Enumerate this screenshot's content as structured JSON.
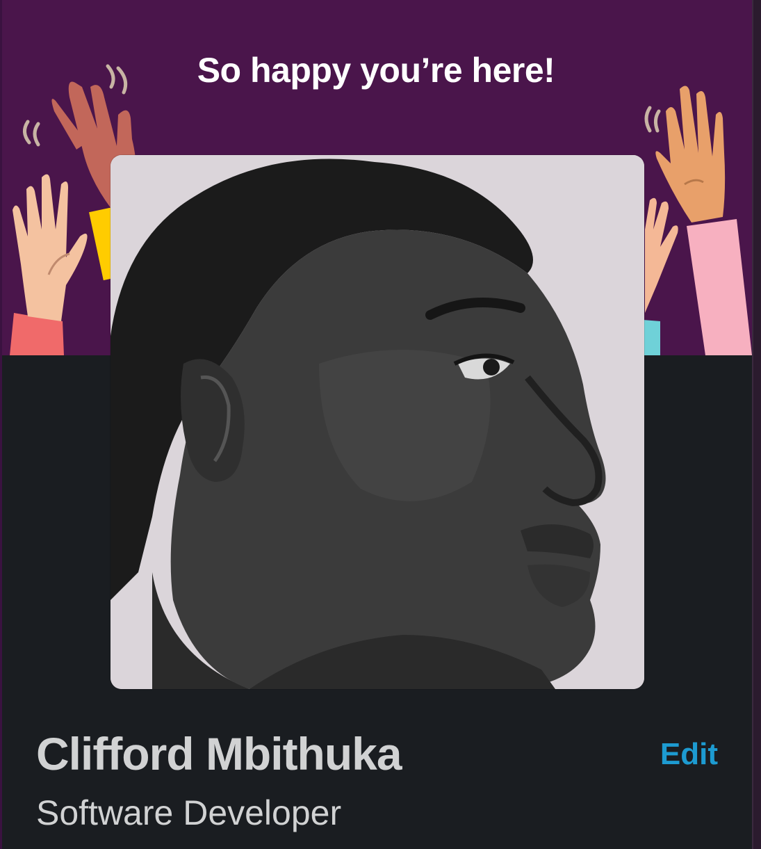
{
  "banner": {
    "title": "So happy you’re here!",
    "background_color": "#4a154b"
  },
  "profile": {
    "photo_icon": "profile-photo",
    "name": "Clifford Mbithuka",
    "title": "Software Developer",
    "edit_label": "Edit"
  },
  "colors": {
    "panel_background": "#1a1d21",
    "text_primary": "#d1d2d3",
    "link": "#1d9bd1"
  }
}
